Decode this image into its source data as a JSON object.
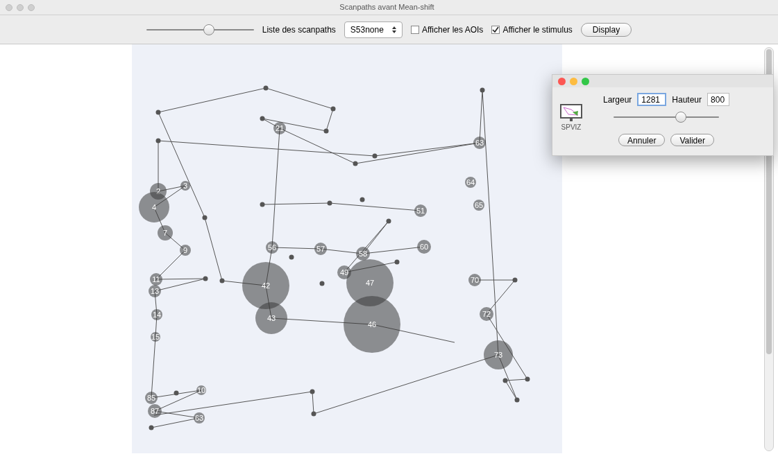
{
  "window": {
    "title": "Scanpaths avant Mean-shift"
  },
  "toolbar": {
    "slider": {
      "level": 0.58
    },
    "scanpath_list": {
      "label": "Liste des scanpaths",
      "value": "S53none"
    },
    "checkboxes": [
      {
        "label": "Afficher les AOIs",
        "checked": false
      },
      {
        "label": "Afficher le stimulus",
        "checked": true
      }
    ],
    "button": "Display"
  },
  "fixations": [
    {
      "label": "2"
    },
    {
      "label": "3"
    },
    {
      "label": "4"
    },
    {
      "label": "7"
    },
    {
      "label": "9"
    },
    {
      "label": "11"
    },
    {
      "label": "13"
    },
    {
      "label": "14"
    },
    {
      "label": "15"
    },
    {
      "label": "21"
    },
    {
      "label": "42"
    },
    {
      "label": "43"
    },
    {
      "label": "47"
    },
    {
      "label": "46"
    },
    {
      "label": "49"
    },
    {
      "label": "51"
    },
    {
      "label": "56"
    },
    {
      "label": "57"
    },
    {
      "label": "58"
    },
    {
      "label": "60"
    },
    {
      "label": "63"
    },
    {
      "label": "64"
    },
    {
      "label": "65"
    },
    {
      "label": "70"
    },
    {
      "label": "72"
    },
    {
      "label": "73"
    },
    {
      "label": "85"
    },
    {
      "label": "87"
    },
    {
      "label": "10"
    },
    {
      "label": "63"
    }
  ],
  "dialog": {
    "logo_text": "SPVIZ",
    "width": {
      "label": "Largeur",
      "value": "1281"
    },
    "height": {
      "label": "Hauteur",
      "value": "800"
    },
    "slider": {
      "level": 0.64
    },
    "buttons": [
      "Annuler",
      "Valider"
    ]
  }
}
